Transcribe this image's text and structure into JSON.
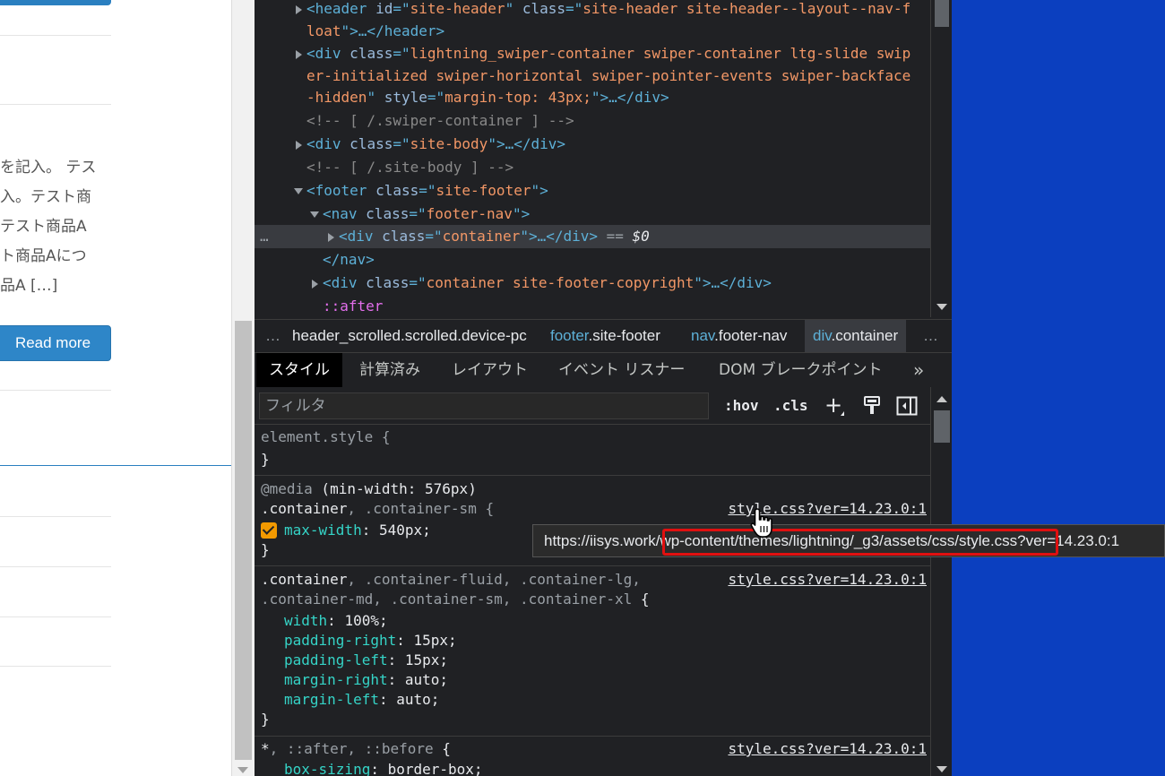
{
  "page": {
    "excerpt_lines": [
      "を記入。 テス",
      "入。テスト商",
      "テスト商品A",
      "ト商品Aにつ",
      "品A […]"
    ],
    "read_more": "Read more"
  },
  "dom": {
    "lines": [
      {
        "parts": [
          [
            "tg",
            "<header "
          ],
          [
            "an",
            "id"
          ],
          [
            "tg",
            "=\""
          ],
          [
            "av",
            "site-header"
          ],
          [
            "tg",
            "\" "
          ],
          [
            "an",
            "class"
          ],
          [
            "tg",
            "=\""
          ],
          [
            "av",
            "site-header site-header--layout--nav-f"
          ]
        ]
      },
      {
        "parts": [
          [
            "av",
            "loat"
          ],
          [
            "tg",
            "\">…</header>"
          ]
        ]
      },
      {
        "parts": [
          [
            "tg",
            "<div "
          ],
          [
            "an",
            "class"
          ],
          [
            "tg",
            "=\""
          ],
          [
            "av",
            "lightning_swiper-container swiper-container ltg-slide swip"
          ]
        ]
      },
      {
        "parts": [
          [
            "av",
            "er-initialized swiper-horizontal swiper-pointer-events swiper-backface"
          ]
        ]
      },
      {
        "parts": [
          [
            "av",
            "-hidden"
          ],
          [
            "tg",
            "\" "
          ],
          [
            "an",
            "style"
          ],
          [
            "tg",
            "=\""
          ],
          [
            "av",
            "margin-top: 43px;"
          ],
          [
            "tg",
            "\">…</div>"
          ]
        ]
      },
      {
        "parts": [
          [
            "cm",
            "<!-- [ /.swiper-container ] -->"
          ]
        ]
      },
      {
        "parts": [
          [
            "tg",
            "<div "
          ],
          [
            "an",
            "class"
          ],
          [
            "tg",
            "=\""
          ],
          [
            "av",
            "site-body"
          ],
          [
            "tg",
            "\">…</div>"
          ]
        ]
      },
      {
        "parts": [
          [
            "cm",
            "<!-- [ /.site-body ] -->"
          ]
        ]
      },
      {
        "parts": [
          [
            "tg",
            "<footer "
          ],
          [
            "an",
            "class"
          ],
          [
            "tg",
            "=\""
          ],
          [
            "av",
            "site-footer"
          ],
          [
            "tg",
            "\">"
          ]
        ]
      },
      {
        "parts": [
          [
            "tg",
            "<nav "
          ],
          [
            "an",
            "class"
          ],
          [
            "tg",
            "=\""
          ],
          [
            "av",
            "footer-nav"
          ],
          [
            "tg",
            "\">"
          ]
        ]
      },
      {
        "parts": [
          [
            "tg",
            "<div "
          ],
          [
            "an",
            "class"
          ],
          [
            "tg",
            "=\""
          ],
          [
            "av",
            "container"
          ],
          [
            "tg",
            "\">…</div>"
          ],
          [
            "eq",
            " == "
          ],
          [
            "dv",
            "$0"
          ]
        ]
      },
      {
        "parts": [
          [
            "tg",
            "</nav>"
          ]
        ]
      },
      {
        "parts": [
          [
            "tg",
            "<div "
          ],
          [
            "an",
            "class"
          ],
          [
            "tg",
            "=\""
          ],
          [
            "av",
            "container site-footer-copyright"
          ],
          [
            "tg",
            "\">…</div>"
          ]
        ]
      },
      {
        "parts": [
          [
            "ps",
            "::after"
          ]
        ]
      }
    ],
    "selected_dots": "…"
  },
  "breadcrumbs": {
    "more_left": "…",
    "items": [
      {
        "text": "header_scrolled.scrolled.device-pc"
      },
      {
        "tag": "footer",
        "rest": ".site-footer"
      },
      {
        "tag": "nav",
        "rest": ".footer-nav"
      },
      {
        "tag": "div",
        "rest": ".container"
      }
    ],
    "more_right": "…"
  },
  "tabs": {
    "styles": "スタイル",
    "computed": "計算済み",
    "layout": "レイアウト",
    "event_listeners": "イベント リスナー",
    "dom_breakpoints": "DOM ブレークポイント",
    "more": "»"
  },
  "filter": {
    "placeholder": "フィルタ",
    "hov": ":hov",
    "cls": ".cls",
    "plus": "+"
  },
  "styles": {
    "element_style": "element.style {",
    "close": "}",
    "media_at": "@media",
    "media_query": " (min-width: 576px)",
    "rule1_sel_a": ".container",
    "rule1_sel_b": ", .container-sm {",
    "rule1_prop": "max-width",
    "rule1_val": ": 540px;",
    "rule1_src": "style.css?ver=14.23.0:1",
    "rule2_sel_l1_a": ".container",
    "rule2_sel_l1_b": ", .container-fluid, .container-lg,",
    "rule2_sel_l2": ".container-md, .container-sm, .container-xl",
    "rule2_brace": " {",
    "rule2_src": "style.css?ver=14.23.0:1",
    "rule2_props": [
      {
        "p": "width",
        "v": ": 100%;"
      },
      {
        "p": "padding-right",
        "v": ": 15px;"
      },
      {
        "p": "padding-left",
        "v": ": 15px;"
      },
      {
        "p": "margin-right",
        "v": ": auto;"
      },
      {
        "p": "margin-left",
        "v": ": auto;"
      }
    ],
    "rule3_sel_a": "*",
    "rule3_sel_b": ", ::after, ::before",
    "rule3_brace": " {",
    "rule3_src": "style.css?ver=14.23.0:1",
    "rule3_prop": "box-sizing",
    "rule3_val": ": border-box;"
  },
  "tooltip": {
    "url": "https://iisys.work/wp-content/themes/lightning/_g3/assets/css/style.css?ver=14.23.0:1"
  },
  "colors": {
    "blue_bg": "#0b3fbf",
    "highlight_red": "#e01010",
    "read_more_bg": "#2e86c8"
  }
}
